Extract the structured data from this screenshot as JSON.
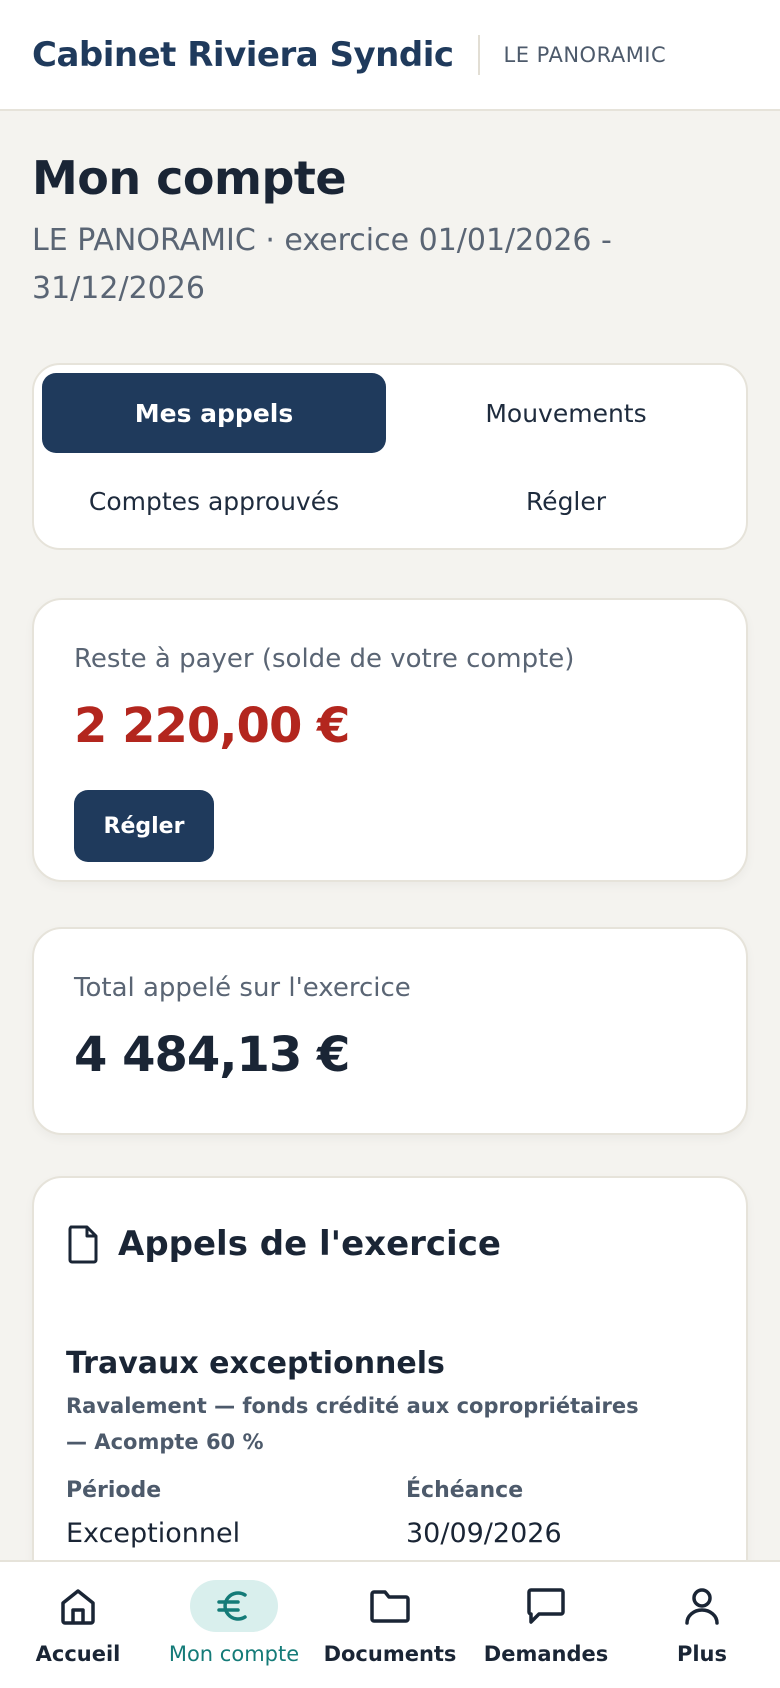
{
  "header": {
    "brand": "Cabinet Riviera Syndic",
    "residence": "LE PANORAMIC"
  },
  "page": {
    "title": "Mon compte",
    "subtitle": "LE PANORAMIC · exercice 01/01/2026 - 31/12/2026"
  },
  "tabs": [
    {
      "label": "Mes appels",
      "active": true
    },
    {
      "label": "Mouvements",
      "active": false
    },
    {
      "label": "Comptes approuvés",
      "active": false
    },
    {
      "label": "Régler",
      "active": false
    }
  ],
  "balance": {
    "label": "Reste à payer (solde de votre compte)",
    "amount": "2 220,00 €",
    "pay_label": "Régler",
    "color": "#b3261e"
  },
  "total": {
    "label": "Total appelé sur l'exercice",
    "amount": "4 484,13 €"
  },
  "calls": {
    "icon": "document-icon",
    "title": "Appels de l'exercice",
    "item": {
      "title": "Travaux exceptionnels",
      "description": "Ravalement — fonds crédité aux copropriétaires — Acompte 60 %",
      "period_label": "Période",
      "period_value": "Exceptionnel",
      "due_label": "Échéance",
      "due_value": "30/09/2026"
    }
  },
  "nav": [
    {
      "label": "Accueil",
      "icon": "home-icon",
      "active": false
    },
    {
      "label": "Mon compte",
      "icon": "euro-icon",
      "active": true
    },
    {
      "label": "Documents",
      "icon": "folder-icon",
      "active": false
    },
    {
      "label": "Demandes",
      "icon": "chat-icon",
      "active": false
    },
    {
      "label": "Plus",
      "icon": "user-icon",
      "active": false
    }
  ],
  "colors": {
    "primary": "#1f3a5c",
    "accent": "#147b78",
    "background": "#f4f3ef"
  }
}
